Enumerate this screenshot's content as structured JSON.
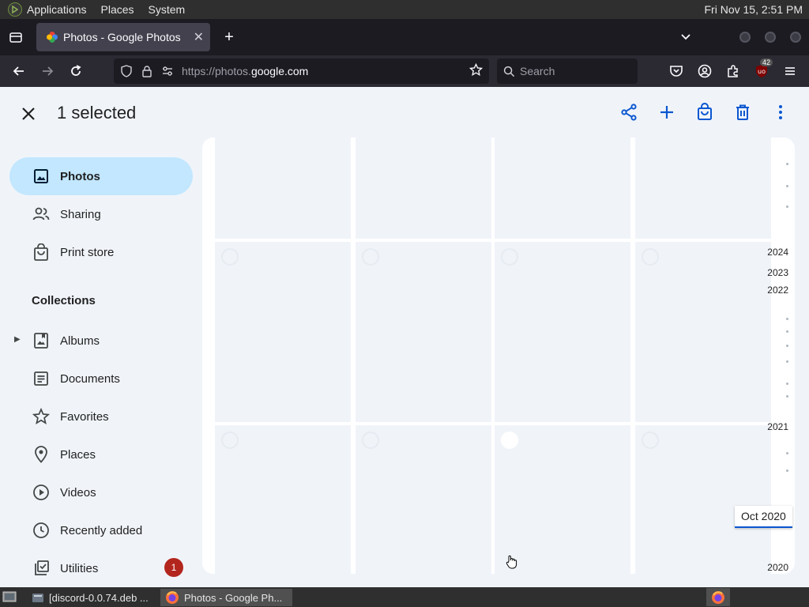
{
  "system_panel": {
    "menus": [
      "Applications",
      "Places",
      "System"
    ],
    "clock": "Fri Nov 15,  2:51 PM"
  },
  "browser": {
    "tab_title": "Photos - Google Photos",
    "url_prefix": "https://photos.",
    "url_domain": "google.com",
    "search_placeholder": "Search",
    "extension_badge": "42"
  },
  "selection_bar": {
    "count_label": "1 selected"
  },
  "sidebar": {
    "items": [
      {
        "label": "Photos",
        "icon": "photo-icon"
      },
      {
        "label": "Sharing",
        "icon": "people-icon"
      },
      {
        "label": "Print store",
        "icon": "shopping-bag-icon"
      }
    ],
    "collections_label": "Collections",
    "collections": [
      {
        "label": "Albums",
        "icon": "album-icon"
      },
      {
        "label": "Documents",
        "icon": "document-icon"
      },
      {
        "label": "Favorites",
        "icon": "star-icon"
      },
      {
        "label": "Places",
        "icon": "pin-icon"
      },
      {
        "label": "Videos",
        "icon": "play-icon"
      },
      {
        "label": "Recently added",
        "icon": "clock-icon"
      },
      {
        "label": "Utilities",
        "icon": "checklist-icon"
      }
    ],
    "utilities_badge": "1"
  },
  "timeline": {
    "years": [
      "2024",
      "2023",
      "2022",
      "2021",
      "2020"
    ],
    "hover_date": "Oct 2020"
  },
  "taskbar": {
    "tasks": [
      "[discord-0.0.74.deb ...",
      "Photos - Google Ph..."
    ]
  },
  "colors": {
    "accent": "#0b57d0",
    "active_nav": "#c2e7ff",
    "badge": "#b3261e"
  }
}
